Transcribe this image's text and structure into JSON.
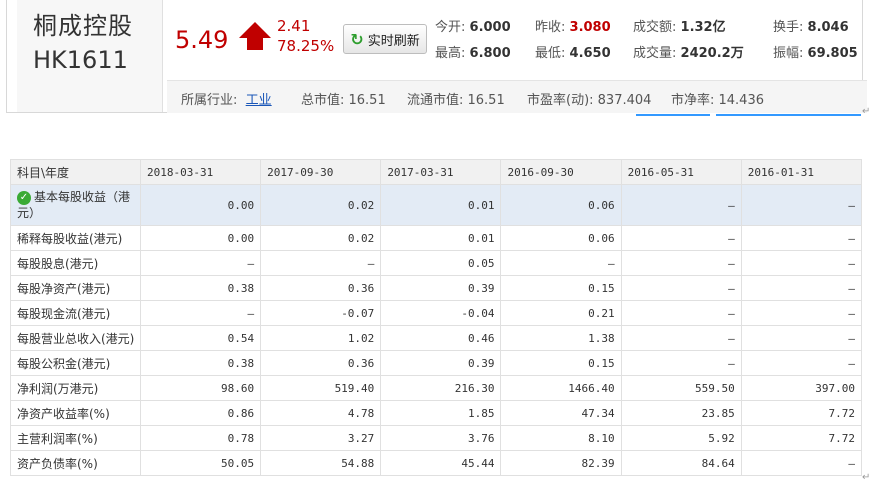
{
  "stock": {
    "name": "桐成控股",
    "code": "HK1611",
    "price": "5.49",
    "change": "2.41",
    "change_pct": "78.25%",
    "refresh_label": "实时刷新"
  },
  "quotes": [
    {
      "label": "今开:",
      "value": "6.000",
      "color": "normal"
    },
    {
      "label": "昨收:",
      "value": "3.080",
      "color": "red"
    },
    {
      "label": "成交额:",
      "value": "1.32亿",
      "color": "normal"
    },
    {
      "label": "换手:",
      "value": "8.046",
      "color": "normal"
    },
    {
      "label": "最高:",
      "value": "6.800",
      "color": "normal"
    },
    {
      "label": "最低:",
      "value": "4.650",
      "color": "normal"
    },
    {
      "label": "成交量:",
      "value": "2420.2万",
      "color": "normal"
    },
    {
      "label": "振幅:",
      "value": "69.805",
      "color": "normal"
    }
  ],
  "info": {
    "industry_label": "所属行业:",
    "industry_value": "工业",
    "market_cap": "总市值: 16.51",
    "float_cap": "流通市值: 16.51",
    "pe": "市盈率(动): 837.404",
    "pb": "市净率: 14.436"
  },
  "table": {
    "header": [
      "科目\\年度",
      "2018-03-31",
      "2017-09-30",
      "2017-03-31",
      "2016-09-30",
      "2016-05-31",
      "2016-01-31"
    ],
    "rows": [
      {
        "label": "基本每股收益（港元）",
        "values": [
          "0.00",
          "0.02",
          "0.01",
          "0.06",
          "—",
          "—"
        ],
        "highlight": true
      },
      {
        "label": "稀释每股收益(港元)",
        "values": [
          "0.00",
          "0.02",
          "0.01",
          "0.06",
          "—",
          "—"
        ]
      },
      {
        "label": "每股股息(港元)",
        "values": [
          "—",
          "—",
          "0.05",
          "—",
          "—",
          "—"
        ]
      },
      {
        "label": "每股净资产(港元)",
        "values": [
          "0.38",
          "0.36",
          "0.39",
          "0.15",
          "—",
          "—"
        ]
      },
      {
        "label": "每股现金流(港元)",
        "values": [
          "—",
          "-0.07",
          "-0.04",
          "0.21",
          "—",
          "—"
        ]
      },
      {
        "label": "每股营业总收入(港元)",
        "values": [
          "0.54",
          "1.02",
          "0.46",
          "1.38",
          "—",
          "—"
        ]
      },
      {
        "label": "每股公积金(港元)",
        "values": [
          "0.38",
          "0.36",
          "0.39",
          "0.15",
          "—",
          "—"
        ]
      },
      {
        "label": "净利润(万港元)",
        "values": [
          "98.60",
          "519.40",
          "216.30",
          "1466.40",
          "559.50",
          "397.00"
        ]
      },
      {
        "label": "净资产收益率(%)",
        "values": [
          "0.86",
          "4.78",
          "1.85",
          "47.34",
          "23.85",
          "7.72"
        ]
      },
      {
        "label": "主营利润率(%)",
        "values": [
          "0.78",
          "3.27",
          "3.76",
          "8.10",
          "5.92",
          "7.72"
        ]
      },
      {
        "label": "资产负债率(%)",
        "values": [
          "50.05",
          "54.88",
          "45.44",
          "82.39",
          "84.64",
          "—"
        ]
      }
    ]
  },
  "colors": {
    "up": "#c00000",
    "accent_blue": "#3399ff",
    "highlight_row": "#e3ebf5",
    "check_green": "#3aaa35"
  }
}
